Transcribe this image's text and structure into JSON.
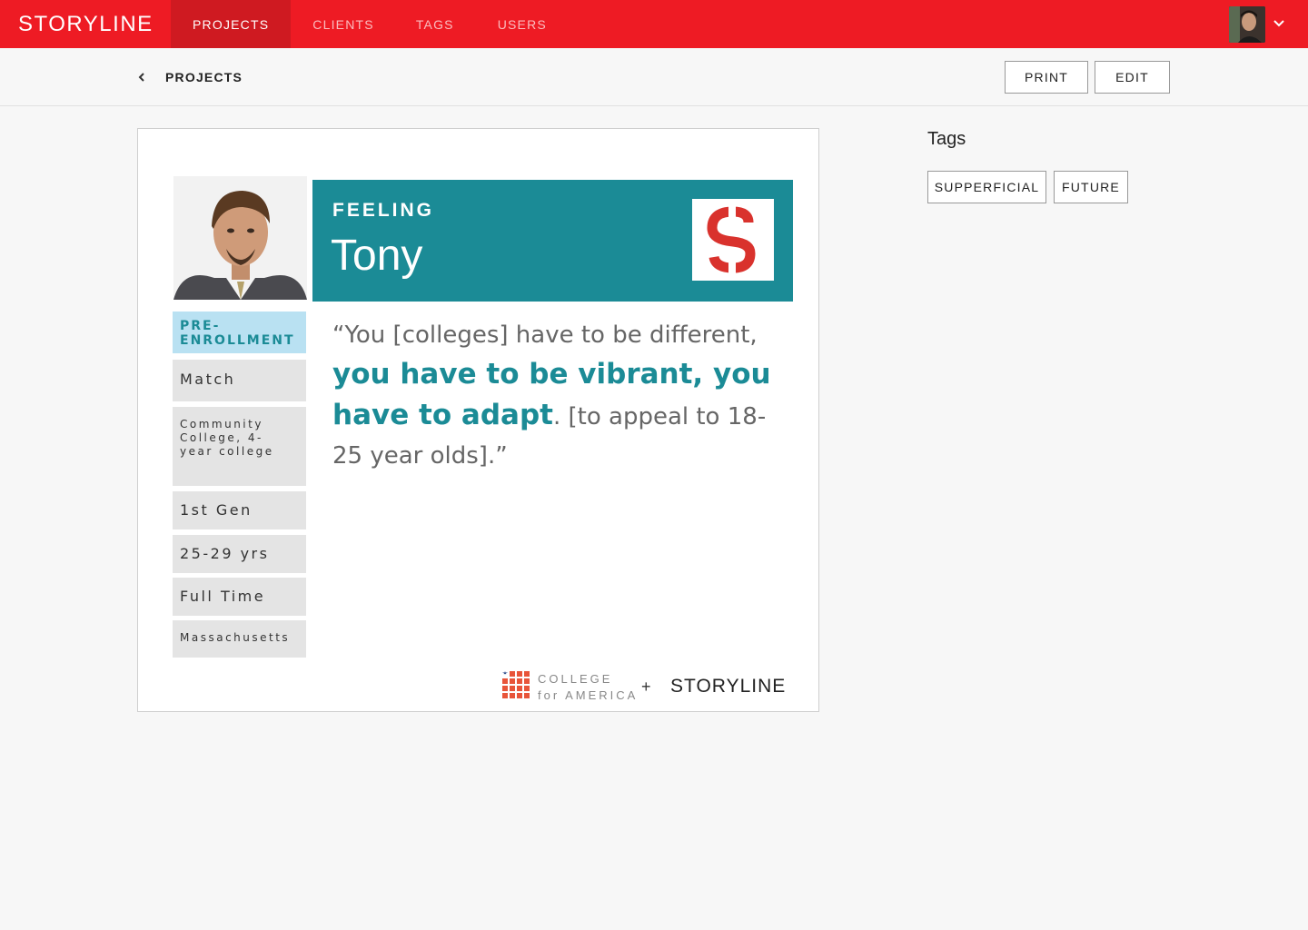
{
  "app": {
    "logo_text": "STORYLINE"
  },
  "nav": {
    "items": [
      {
        "label": "PROJECTS",
        "active": true
      },
      {
        "label": "CLIENTS",
        "active": false
      },
      {
        "label": "TAGS",
        "active": false
      },
      {
        "label": "USERS",
        "active": false
      }
    ]
  },
  "header": {
    "breadcrumb": "PROJECTS",
    "print_label": "PRINT",
    "edit_label": "EDIT"
  },
  "card": {
    "heading": "FEELING",
    "persona_name": "Tony",
    "attributes": [
      "PRE-\nENROLLMENT",
      "Match",
      "Community\nCollege, 4-\nyear college",
      "1st Gen",
      "25-29 yrs",
      "Full Time",
      "Massachusetts"
    ],
    "quote": {
      "lead": "“You [colleges] have to be different,",
      "emphasis": "you have to be vibrant, you have to adapt",
      "tail": ". [to appeal to 18-25 year olds].”"
    },
    "footer": {
      "partner_line1": "COLLEGE",
      "partner_line2": "for AMERICA",
      "plus": "+",
      "brand": "STORYLINE"
    }
  },
  "tags_panel": {
    "title": "Tags",
    "tags": [
      "SUPPERFICIAL",
      "FUTURE"
    ]
  },
  "colors": {
    "brand_red": "#ee1b24",
    "active_nav": "#cf1a21",
    "teal": "#1b8b96",
    "light_blue": "#b9e1f2"
  },
  "icons": {
    "back": "chevron-left-icon",
    "menu": "chevron-down-icon"
  }
}
